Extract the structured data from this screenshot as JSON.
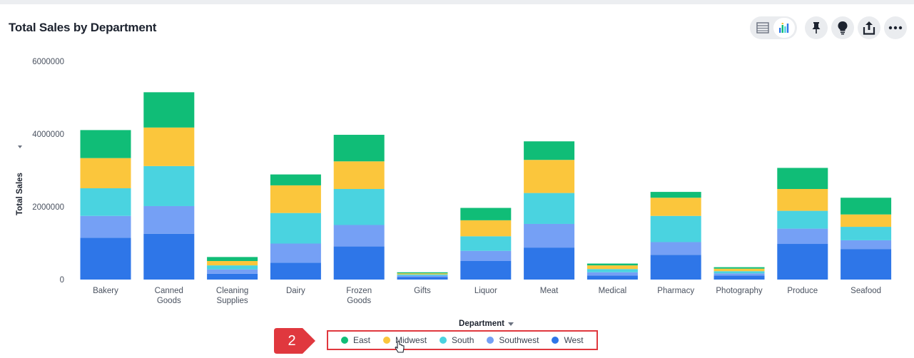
{
  "title": "Total Sales by Department",
  "toolbar": {
    "icons": [
      "table-icon",
      "chart-icon",
      "pin-icon",
      "lightbulb-icon",
      "share-icon",
      "more-icon"
    ]
  },
  "callout": {
    "number": "2"
  },
  "colors": {
    "East": "#10bd77",
    "Midwest": "#fbc63c",
    "South": "#4ad3e0",
    "Southwest": "#75a0f5",
    "West": "#2e76e8",
    "highlight": "#e0383e"
  },
  "chart_data": {
    "type": "bar",
    "stacked": true,
    "title": "Total Sales by Department",
    "xlabel": "Department",
    "ylabel": "Total Sales",
    "ylim": [
      0,
      6000000
    ],
    "yticks": [
      "0",
      "2000000",
      "4000000",
      "6000000"
    ],
    "categories": [
      "Bakery",
      "Canned Goods",
      "Cleaning Supplies",
      "Dairy",
      "Frozen Goods",
      "Gifts",
      "Liquor",
      "Meat",
      "Medical",
      "Pharmacy",
      "Photography",
      "Produce",
      "Seafood"
    ],
    "series": [
      {
        "name": "West",
        "values": [
          1150000,
          1260000,
          160000,
          460000,
          910000,
          70000,
          510000,
          880000,
          110000,
          680000,
          110000,
          980000,
          840000
        ]
      },
      {
        "name": "Southwest",
        "values": [
          600000,
          760000,
          120000,
          530000,
          590000,
          40000,
          280000,
          650000,
          90000,
          350000,
          60000,
          420000,
          240000
        ]
      },
      {
        "name": "South",
        "values": [
          760000,
          1100000,
          110000,
          840000,
          990000,
          30000,
          400000,
          850000,
          90000,
          720000,
          60000,
          490000,
          370000
        ]
      },
      {
        "name": "Midwest",
        "values": [
          830000,
          1060000,
          120000,
          760000,
          760000,
          30000,
          440000,
          910000,
          100000,
          500000,
          70000,
          600000,
          340000
        ]
      },
      {
        "name": "East",
        "values": [
          770000,
          970000,
          110000,
          300000,
          730000,
          30000,
          340000,
          510000,
          50000,
          160000,
          40000,
          580000,
          460000
        ]
      }
    ],
    "legend_order": [
      "East",
      "Midwest",
      "South",
      "Southwest",
      "West"
    ],
    "legend_position": "bottom",
    "grid": false
  }
}
